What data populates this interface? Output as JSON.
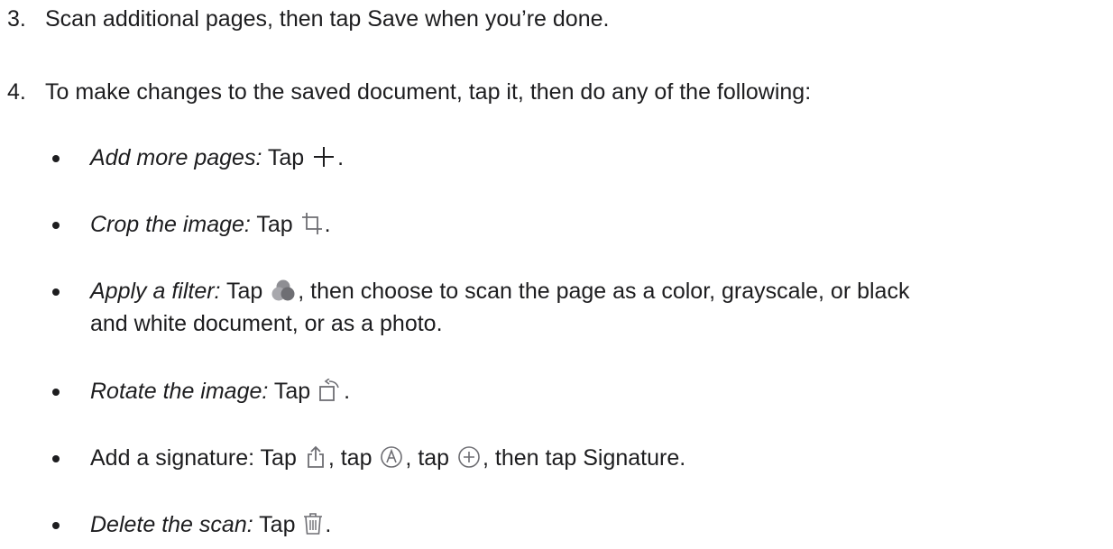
{
  "steps": [
    {
      "num": "3.",
      "text": "Scan additional pages, then tap Save when you’re done."
    },
    {
      "num": "4.",
      "text": "To make changes to the saved document, tap it, then do any of the following:"
    }
  ],
  "bullets": {
    "add": {
      "label": "Add more pages:",
      "pre": " Tap ",
      "icon": "plus-icon",
      "post": "."
    },
    "crop": {
      "label": "Crop the image:",
      "pre": " Tap ",
      "icon": "crop-icon",
      "post": "."
    },
    "filter": {
      "label": "Apply a filter:",
      "pre": " Tap ",
      "icon": "filter-icon",
      "post_line1": ", then choose to scan the page as a color, grayscale, or black",
      "post_line2": "and white document, or as a photo."
    },
    "rotate": {
      "label": "Rotate the image:",
      "pre": " Tap ",
      "icon": "rotate-icon",
      "post": "."
    },
    "signature": {
      "text1": "Add a signature: Tap ",
      "text2": ", tap ",
      "text3": ", tap ",
      "text4": ", then tap Signature.",
      "icons": [
        "share-icon",
        "markup-icon",
        "add-circle-icon"
      ]
    },
    "delete": {
      "label": "Delete the scan:",
      "pre": " Tap ",
      "icon": "trash-icon",
      "post": "."
    }
  },
  "colors": {
    "text": "#1d1d1f",
    "icon": "#6e6e73"
  }
}
